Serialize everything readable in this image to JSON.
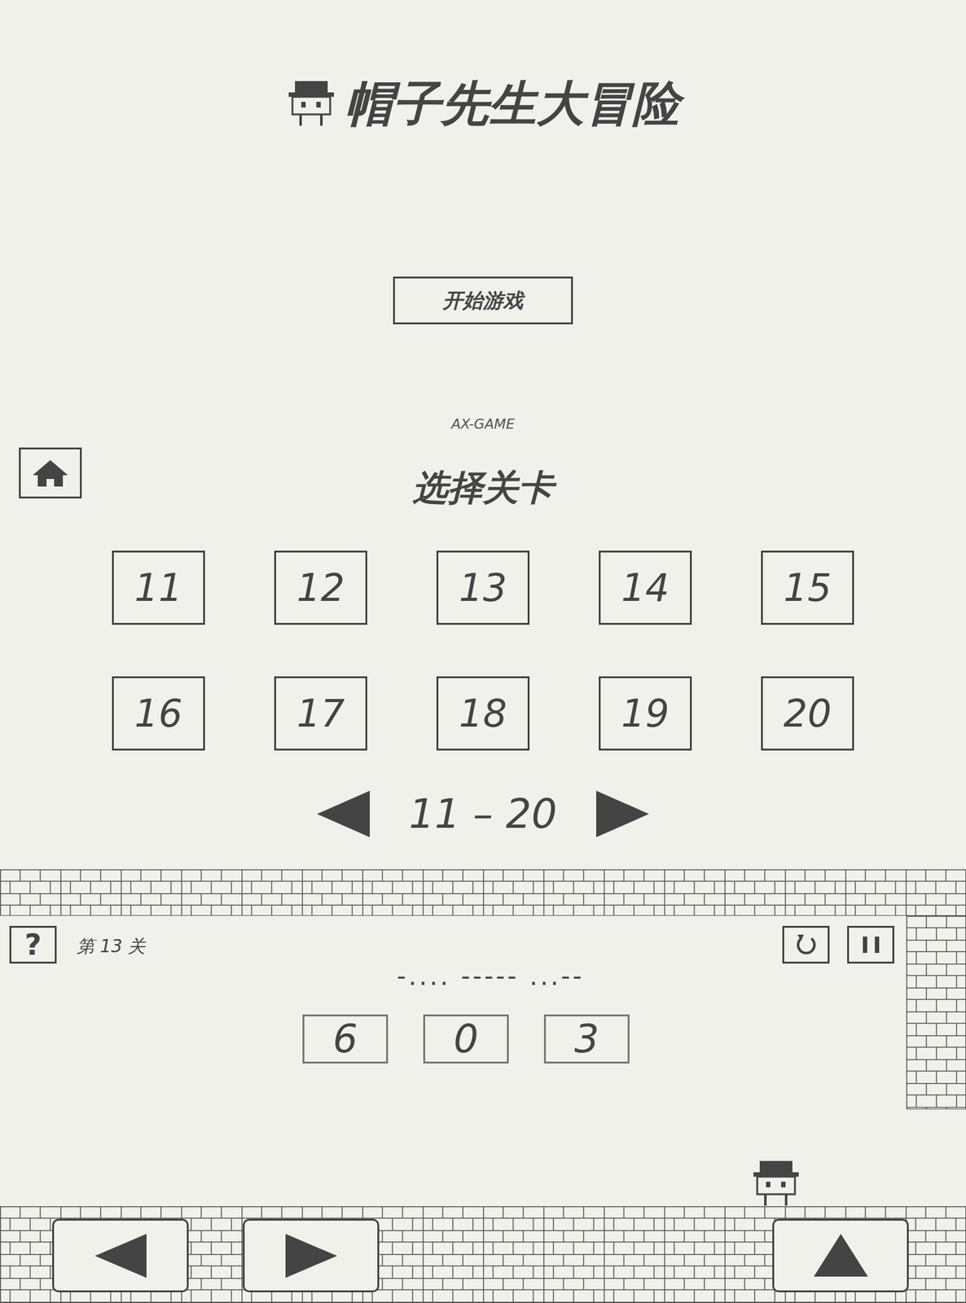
{
  "title_screen": {
    "title": "帽子先生大冒险",
    "start_button": "开始游戏",
    "credit": "AX-GAME"
  },
  "level_select": {
    "title": "选择关卡",
    "levels": [
      "11",
      "12",
      "13",
      "14",
      "15",
      "16",
      "17",
      "18",
      "19",
      "20"
    ],
    "page_label": "11 – 20"
  },
  "game": {
    "help": "?",
    "level_label": "第 13 关",
    "clue": "-.... ----- ...--",
    "answer": [
      "6",
      "0",
      "3"
    ]
  }
}
